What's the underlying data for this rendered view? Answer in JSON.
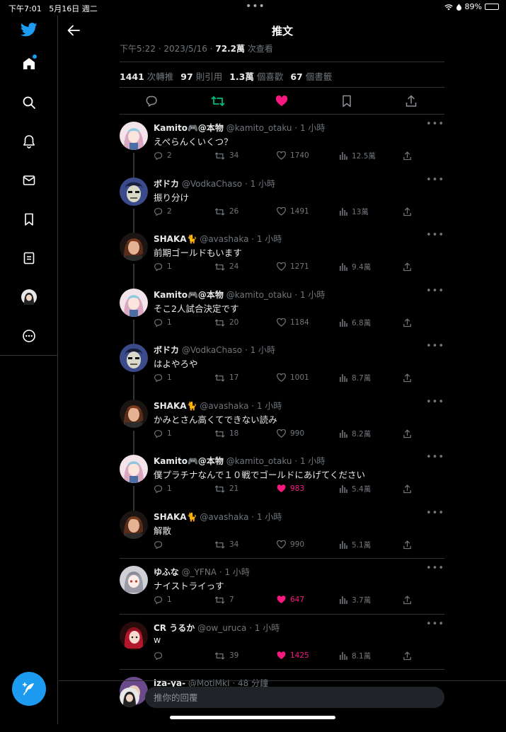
{
  "status": {
    "time": "下午7:01",
    "date": "5月16日 週二",
    "dots": "•••",
    "battery": "89%",
    "battery_level": 0.89
  },
  "header": {
    "title": "推文"
  },
  "tweet": {
    "meta_prefix": "下午5:22 · 2023/5/16 · ",
    "views": "72.2萬",
    "views_label": " 次查看",
    "stats": [
      {
        "value": "1441",
        "label": "次轉推"
      },
      {
        "value": "97",
        "label": "則引用"
      },
      {
        "value": "1.3萬",
        "label": "個喜歡"
      },
      {
        "value": "67",
        "label": "個書籤"
      }
    ],
    "retweeted": true,
    "liked": true
  },
  "replies": [
    {
      "name": "Kamito🎮@本物",
      "handle": "@kamito_otaku",
      "time": "· 1 小時",
      "text": "えぺらんくいくつ？",
      "replies": "2",
      "retweets": "34",
      "likes": "1740",
      "views": "12.5萬",
      "liked": false,
      "avatar": "kamito"
    },
    {
      "name": "ボドカ",
      "handle": "@VodkaChaso",
      "time": "· 1 小時",
      "text": "振り分け",
      "replies": "2",
      "retweets": "26",
      "likes": "1491",
      "views": "13萬",
      "liked": false,
      "avatar": "vodka"
    },
    {
      "name": "SHAKA🐈",
      "handle": "@avashaka",
      "time": "· 1 小時",
      "text": "前期ゴールドもいます",
      "replies": "1",
      "retweets": "24",
      "likes": "1271",
      "views": "9.4萬",
      "liked": false,
      "avatar": "shaka"
    },
    {
      "name": "Kamito🎮@本物",
      "handle": "@kamito_otaku",
      "time": "· 1 小時",
      "text": "そこ2人試合決定です",
      "replies": "1",
      "retweets": "20",
      "likes": "1184",
      "views": "6.8萬",
      "liked": false,
      "avatar": "kamito"
    },
    {
      "name": "ボドカ",
      "handle": "@VodkaChaso",
      "time": "· 1 小時",
      "text": "はよやろや",
      "replies": "1",
      "retweets": "17",
      "likes": "1001",
      "views": "8.7萬",
      "liked": false,
      "avatar": "vodka"
    },
    {
      "name": "SHAKA🐈",
      "handle": "@avashaka",
      "time": "· 1 小時",
      "text": "かみとさん高くてできない読み",
      "replies": "1",
      "retweets": "18",
      "likes": "990",
      "views": "8.2萬",
      "liked": false,
      "avatar": "shaka"
    },
    {
      "name": "Kamito🎮@本物",
      "handle": "@kamito_otaku",
      "time": "· 1 小時",
      "text": "僕プラチナなんで１０戦でゴールドにあげてください",
      "replies": "1",
      "retweets": "21",
      "likes": "983",
      "views": "5.4萬",
      "liked": true,
      "avatar": "kamito"
    },
    {
      "name": "SHAKA🐈",
      "handle": "@avashaka",
      "time": "· 1 小時",
      "text": "解散",
      "replies": "",
      "retweets": "34",
      "likes": "990",
      "views": "5.1萬",
      "liked": false,
      "avatar": "shaka"
    },
    {
      "name": "ゆふな",
      "handle": "@_YFNA",
      "time": "· 1 小時",
      "text": "ナイストライっす",
      "replies": "1",
      "retweets": "7",
      "likes": "647",
      "views": "3.7萬",
      "liked": true,
      "avatar": "yufuna"
    },
    {
      "name": "CR うるか",
      "handle": "@ow_uruca",
      "time": "· 1 小時",
      "text": "w",
      "replies": "",
      "retweets": "39",
      "likes": "1425",
      "views": "8.1萬",
      "liked": true,
      "avatar": "uruca"
    },
    {
      "name": "iza-ya-",
      "handle": "@MotiMkI",
      "time": "· 48 分鐘",
      "text": "",
      "replies": "",
      "retweets": "",
      "likes": "",
      "views": "",
      "liked": false,
      "avatar": "iza"
    }
  ],
  "reply_box": {
    "placeholder": "推你的回覆"
  },
  "colors": {
    "accent": "#1d9bf0",
    "retweet": "#00ba7c",
    "like": "#f91880",
    "muted": "#71767b"
  },
  "icons": {
    "sidebar": [
      "twitter-bird-icon",
      "home-icon",
      "search-icon",
      "bell-icon",
      "mail-icon",
      "bookmark-icon",
      "list-icon",
      "profile-avatar",
      "more-circle-icon"
    ],
    "compose": "feather-plus-icon"
  }
}
